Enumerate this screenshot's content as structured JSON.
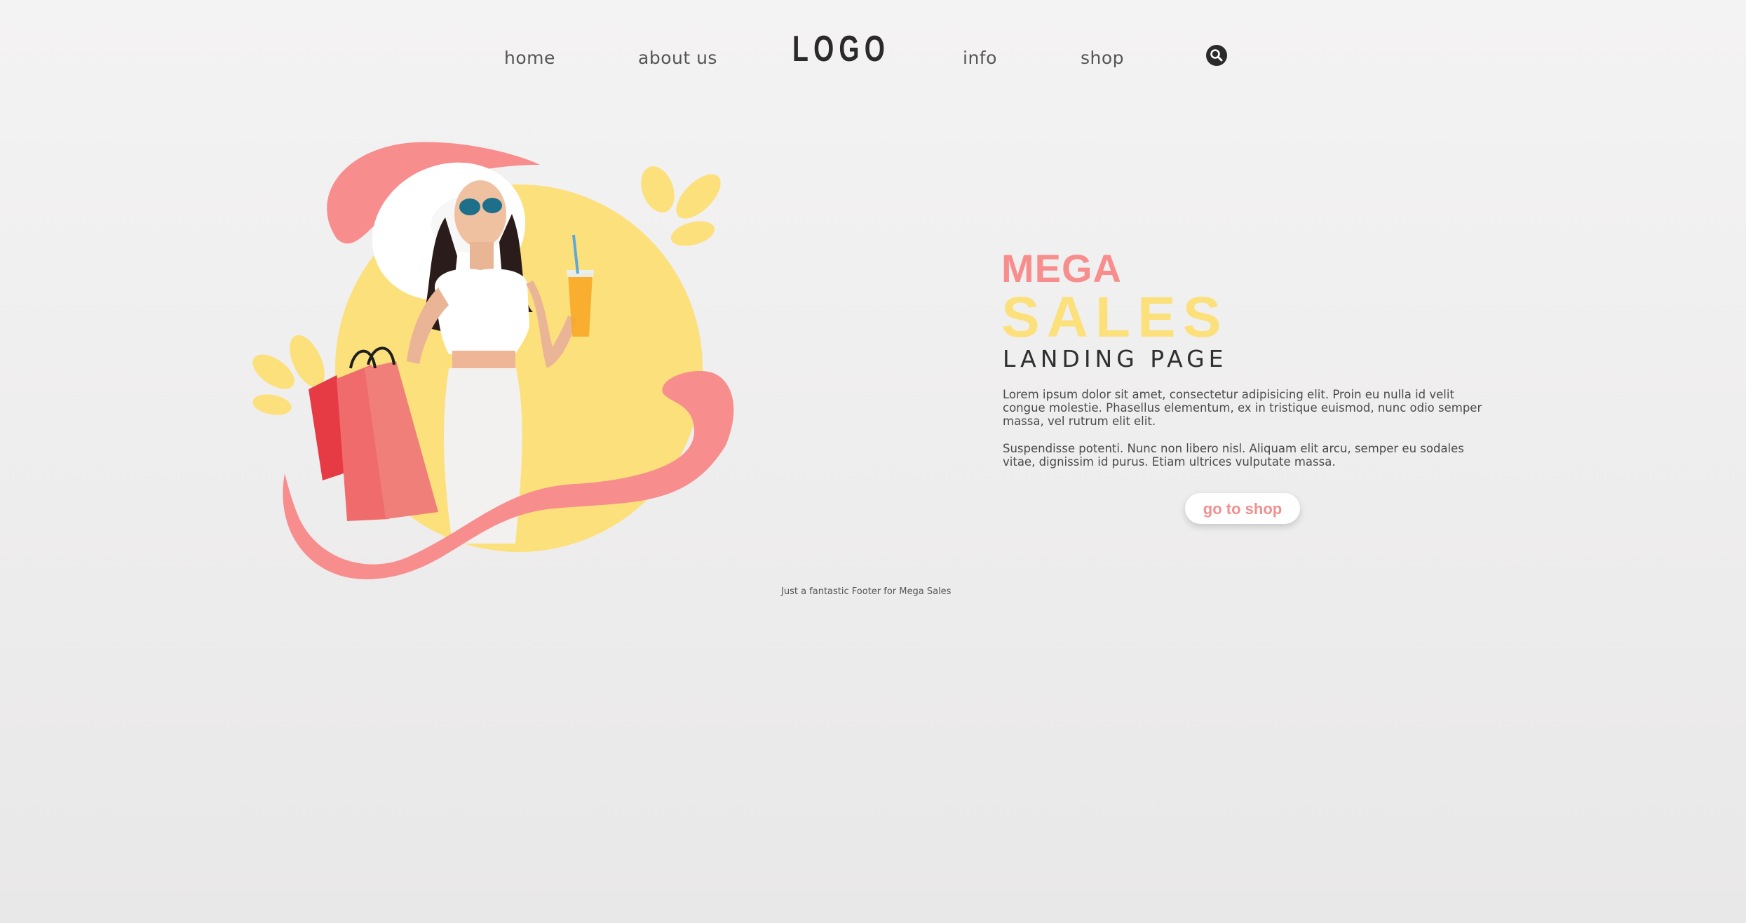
{
  "nav": {
    "home": "home",
    "about": "about us",
    "logo": "LOGO",
    "info": "info",
    "shop": "shop",
    "search_icon": "search-icon"
  },
  "hero": {
    "image": "woman-shopping-illustration",
    "colors": {
      "pink": "#f88d8d",
      "yellow": "#fce07c"
    }
  },
  "content": {
    "mega": "MEGA",
    "sales": "SALES",
    "landing": "LANDING PAGE",
    "paragraph_1": "Lorem ipsum dolor sit amet, consectetur adipisicing elit. Proin eu nulla id velit congue molestie. Phasellus elementum, ex in tristique euismod, nunc odio semper massa, vel rutrum elit elit.",
    "paragraph_2": "Suspendisse potenti. Nunc non libero nisl. Aliquam elit arcu, semper eu sodales vitae, dignissim id purus. Etiam ultrices vulputate massa.",
    "button_label": "go to shop"
  },
  "footer": {
    "text": "Just a fantastic Footer for Mega Sales"
  }
}
